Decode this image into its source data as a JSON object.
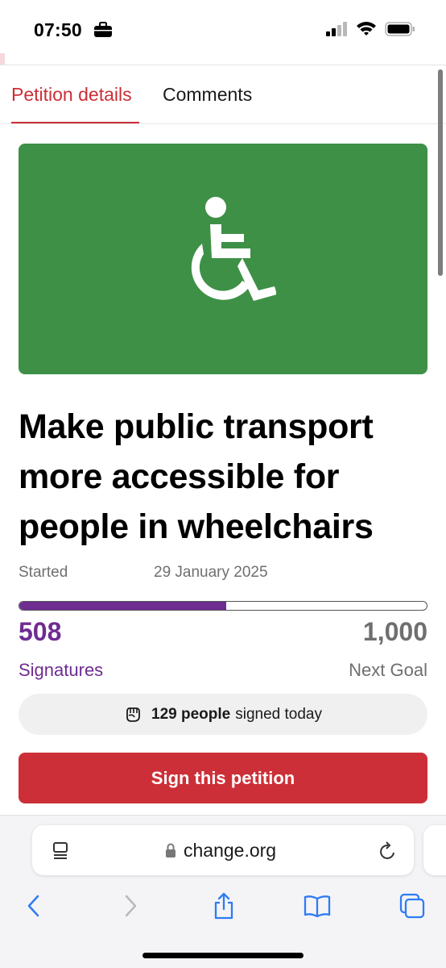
{
  "status_bar": {
    "time": "07:50",
    "icons": [
      "briefcase-icon",
      "signal-icon",
      "wifi-icon",
      "battery-icon"
    ]
  },
  "tabs": [
    {
      "label": "Petition details",
      "active": true
    },
    {
      "label": "Comments",
      "active": false
    }
  ],
  "hero": {
    "icon": "wheelchair-icon",
    "background_color": "#3e9046"
  },
  "petition": {
    "title": "Make public transport more accessible for people in wheelchairs",
    "started_label": "Started",
    "started_date": "29 January 2025",
    "progress_fraction": 0.508,
    "signatures_count": "508",
    "signatures_label": "Signatures",
    "goal_count": "1,000",
    "goal_label": "Next Goal",
    "today": {
      "icon": "raised-fist-icon",
      "count_text": "129 people",
      "rest_text": "signed today"
    },
    "sign_button_label": "Sign this petition"
  },
  "browser": {
    "url": "change.org",
    "icons": [
      "reader-icon",
      "lock-icon",
      "reload-icon"
    ],
    "toolbar": [
      "back-icon",
      "forward-icon",
      "share-icon",
      "bookmarks-icon",
      "tabs-icon"
    ]
  },
  "colors": {
    "accent_red": "#cc2f37",
    "purple": "#6f2c91",
    "hero_green": "#3e9046",
    "muted_gray": "#6f6f6f"
  }
}
